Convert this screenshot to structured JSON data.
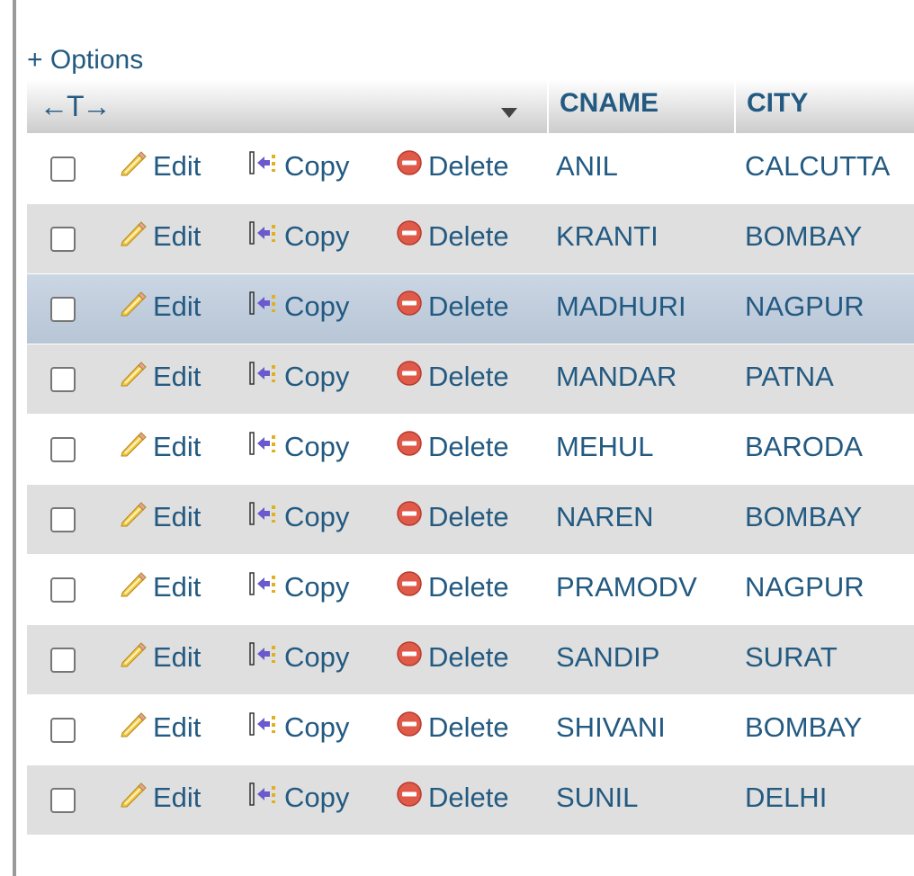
{
  "options_label": "+ Options",
  "header": {
    "arrows": "←T→",
    "columns": [
      "CNAME",
      "CITY"
    ]
  },
  "actions": {
    "edit": "Edit",
    "copy": "Copy",
    "delete": "Delete"
  },
  "rows": [
    {
      "cname": "ANIL",
      "city": "CALCUTTA"
    },
    {
      "cname": "KRANTI",
      "city": "BOMBAY"
    },
    {
      "cname": "MADHURI",
      "city": "NAGPUR"
    },
    {
      "cname": "MANDAR",
      "city": "PATNA"
    },
    {
      "cname": "MEHUL",
      "city": "BARODA"
    },
    {
      "cname": "NAREN",
      "city": "BOMBAY"
    },
    {
      "cname": "PRAMODV",
      "city": "NAGPUR"
    },
    {
      "cname": "SANDIP",
      "city": "SURAT"
    },
    {
      "cname": "SHIVANI",
      "city": "BOMBAY"
    },
    {
      "cname": "SUNIL",
      "city": "DELHI"
    }
  ],
  "highlighted_row": 2,
  "icons": {
    "edit": "pencil-icon",
    "copy": "copy-icon",
    "delete": "delete-icon",
    "sort": "sort-triangle-icon"
  },
  "colors": {
    "link": "#235a81",
    "row_even": "#dfdfdf",
    "row_marked": "#c3cfdc"
  }
}
